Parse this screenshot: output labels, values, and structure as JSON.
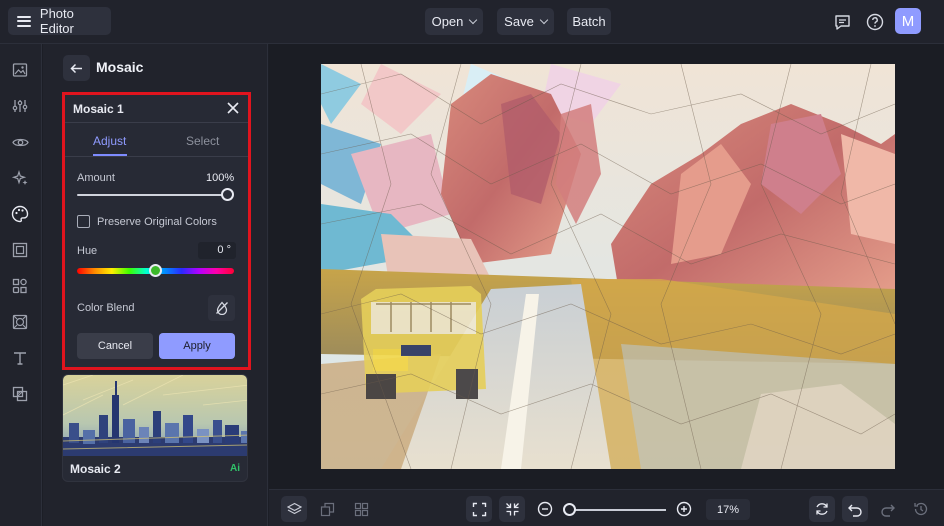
{
  "app": {
    "title": "Photo Editor",
    "avatar_letter": "M"
  },
  "topbar": {
    "open_label": "Open",
    "save_label": "Save",
    "batch_label": "Batch"
  },
  "panel": {
    "title": "Mosaic",
    "effect": {
      "title": "Mosaic 1",
      "tabs": [
        {
          "label": "Adjust",
          "active": true
        },
        {
          "label": "Select",
          "active": false
        }
      ],
      "amount_label": "Amount",
      "amount_value": "100%",
      "amount_fraction": 1.0,
      "preserve_label": "Preserve Original Colors",
      "preserve_checked": false,
      "hue_label": "Hue",
      "hue_value": "0 °",
      "hue_fraction": 0.5,
      "blend_label": "Color Blend",
      "cancel_label": "Cancel",
      "apply_label": "Apply"
    },
    "presets": [
      {
        "name": "Mosaic 2",
        "badge": "Ai"
      }
    ]
  },
  "zoom": {
    "percent": "17%",
    "fraction": 0.0
  },
  "colors": {
    "accent": "#8f9bff",
    "highlight_border": "#e0141e",
    "ai_badge": "#30c36a"
  },
  "icons": {
    "rail": [
      "image-icon",
      "sliders-icon",
      "eye-icon",
      "sparkles-icon",
      "palette-icon",
      "frame-icon",
      "shapes-icon",
      "texture-icon",
      "text-icon",
      "layers-overlay-icon"
    ],
    "bottom_left": [
      "layers-icon",
      "copy-icon",
      "grid-icon"
    ],
    "bottom_right": [
      "refresh-icon",
      "undo-icon",
      "redo-icon",
      "history-icon"
    ]
  }
}
